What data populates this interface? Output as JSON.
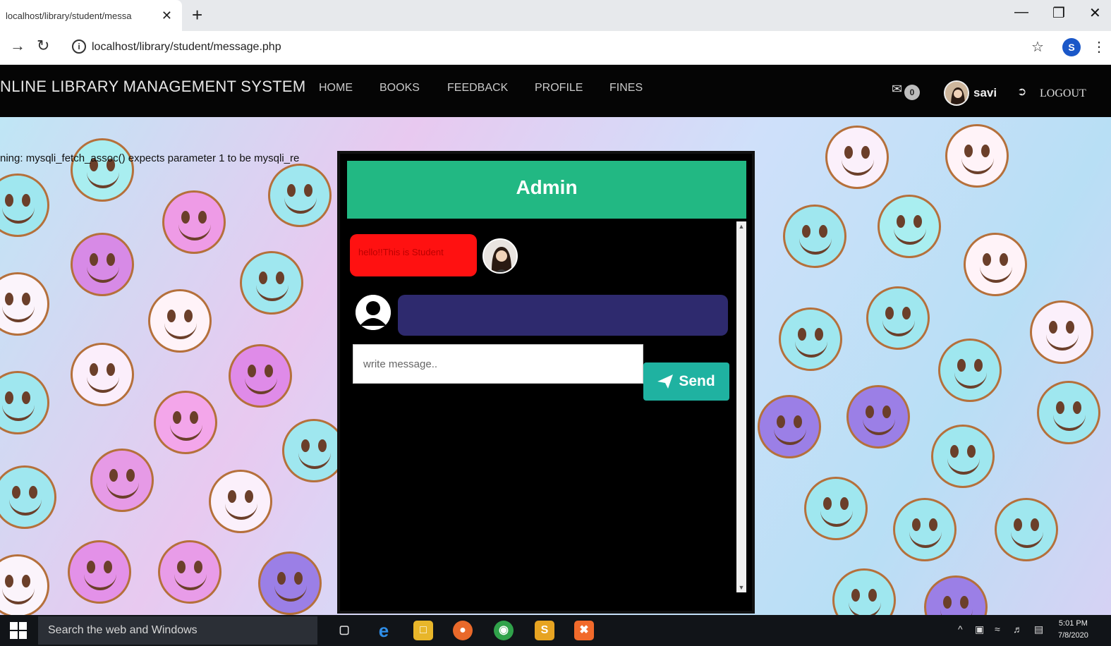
{
  "browser": {
    "tab_title": "localhost/library/student/messa",
    "tab_close": "✕",
    "new_tab": "+",
    "url": "localhost/library/student/message.php",
    "profile_letter": "S"
  },
  "navbar": {
    "brand": "NLINE LIBRARY MANAGEMENT SYSTEM",
    "links": [
      "HOME",
      "BOOKS",
      "FEEDBACK",
      "PROFILE",
      "FINES"
    ],
    "message_count": "0",
    "username": "savi",
    "logout_label": "LOGOUT"
  },
  "warning_text": "ning: mysqli_fetch_assoc() expects parameter 1 to be mysqli_re",
  "chat": {
    "title": "Admin",
    "messages": [
      {
        "from": "student",
        "text": "hello!!This is Student"
      },
      {
        "from": "admin",
        "text": ""
      }
    ],
    "input_placeholder": "write message..",
    "send_label": "Send"
  },
  "taskbar": {
    "search_text": "Search the web and Windows",
    "time": "5:01 PM",
    "date": "7/8/2020"
  },
  "icons": {
    "back": "back-arrow-icon",
    "reload": "reload-icon",
    "info": "info-icon",
    "star": "star-icon",
    "mail": "mail-icon",
    "logout": "logout-icon",
    "send": "paper-plane-icon"
  },
  "colors": {
    "navbar_bg": "#050505",
    "chat_header": "#22b883",
    "student_bubble": "#ff1111",
    "admin_bubble": "#2e2a6e",
    "send_button": "#1fb2a1"
  }
}
